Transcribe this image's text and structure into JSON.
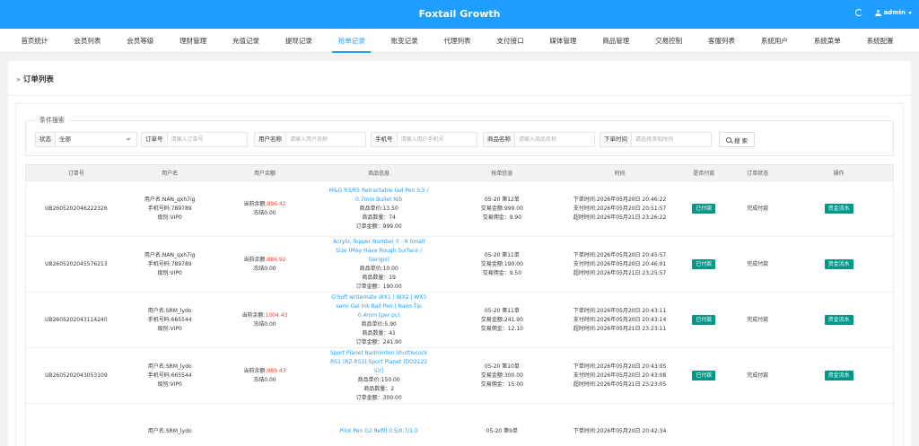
{
  "header": {
    "title": "Foxtail Growth",
    "user": "admin"
  },
  "nav": [
    "首页统计",
    "会员列表",
    "会员等级",
    "理财管理",
    "充值记录",
    "提现记录",
    "抢单记录",
    "账变记录",
    "代理列表",
    "支付接口",
    "媒体管理",
    "商品管理",
    "交易控制",
    "客服列表",
    "系统用户",
    "系统菜单",
    "系统配置"
  ],
  "page": {
    "title": "订单列表"
  },
  "search": {
    "legend": "条件搜索",
    "status_label": "状态",
    "status_value": "全部",
    "order_label": "订单号",
    "order_placeholder": "请输入订单号",
    "username_label": "用户名称",
    "username_placeholder": "请输入用户名称",
    "phone_label": "手机号",
    "phone_placeholder": "请输入用户手机号",
    "product_label": "商品名称",
    "product_placeholder": "请输入商品名称",
    "time_label": "下单时间",
    "time_placeholder": "请选择添加时间",
    "search_button": "搜 索"
  },
  "table": {
    "headers": [
      "订单号",
      "用户名",
      "用户余额",
      "商品信息",
      "抢单信息",
      "时间",
      "是否付款",
      "订单状态",
      "操作"
    ],
    "rows": [
      {
        "order_no": "UB2605202046222326",
        "user_line1": "用户名:NAN_qxh7ig",
        "user_line2": "手机号码:789789",
        "user_line3": "级别:VIP0",
        "balance_label": "当前余额:",
        "balance_value": "896.42",
        "frozen": "冻结0.00",
        "product_name": "M&G R3/R5 Retractable Gel Pen 0.5 / 0.7mm Bullet Nib",
        "unit_price": "商品单价:13.50",
        "qty": "商品数量：74",
        "total": "订单金额：999.00",
        "grab_line1": "05-20 第12单",
        "grab_line2": "交易金额:999.00",
        "grab_line3": "交易佣金：9.90",
        "time_line1": "下单时间:2026年05月20日 20:46:22",
        "time_line2": "支付时间:2026年05月20日 20:51:57",
        "time_line3": "超时时间:2026年05月21日 23:26:22",
        "paid": "已付款",
        "status": "完成付款",
        "action": "资金流水"
      },
      {
        "order_no": "UB2605202045576213",
        "user_line1": "用户名:NAN_qxh7ig",
        "user_line2": "手机号码:789789",
        "user_line3": "级别:VIP0",
        "balance_label": "当前余额:",
        "balance_value": "886.92",
        "frozen": "冻结0.00",
        "product_name": "Acrylic Topper Number 0 - 9 Small Size (May Have Rough Surface / Gerigis)",
        "unit_price": "商品单价:10.00",
        "qty": "商品数量：19",
        "total": "订单金额：190.00",
        "grab_line1": "05-20 第11单",
        "grab_line2": "交易金额:190.00",
        "grab_line3": "交易佣金：9.50",
        "time_line1": "下单时间:2026年05月20日 20:45:57",
        "time_line2": "支付时间:2026年05月20日 20:46:01",
        "time_line3": "超时时间:2026年05月21日 23:25:57",
        "paid": "已付款",
        "status": "完成付款",
        "action": "资金流水"
      },
      {
        "order_no": "UB2605202043114240",
        "user_line1": "用户名:SRM_lydo",
        "user_line2": "手机号码:665544",
        "user_line3": "级别:VIP0",
        "balance_label": "当前余额:",
        "balance_value": "1004.43",
        "frozen": "冻结0.00",
        "product_name": "G'Soft writemate WX1 | WX2 | WX3 semi Gel Ink Ball Pen | Nano Tip 0.4mm (per pc)",
        "unit_price": "商品单价:5.90",
        "qty": "商品数量：41",
        "total": "订单金额：241.90",
        "grab_line1": "05-20 第11单",
        "grab_line2": "交易金额:241.90",
        "grab_line3": "交易佣金：12.10",
        "time_line1": "下单时间:2026年05月20日 20:43:11",
        "time_line2": "支付时间:2026年05月20日 20:43:14",
        "time_line3": "超时时间:2026年05月21日 23:23:11",
        "paid": "已付款",
        "status": "完成付款",
        "action": "资金流水"
      },
      {
        "order_no": "UB2605202043053109",
        "user_line1": "用户名:SRM_lydo",
        "user_line2": "手机号码:665544",
        "user_line3": "级别:VIP0",
        "balance_label": "当前余额:",
        "balance_value": "989.43",
        "frozen": "冻结0.00",
        "product_name": "Sport Planet Badminton Shuttlecock RS1 (RZ-RS1) Sport Planet (DO2122 S)()",
        "unit_price": "商品单价:150.00",
        "qty": "商品数量：2",
        "total": "订单金额：300.00",
        "grab_line1": "05-20 第10单",
        "grab_line2": "交易金额:300.00",
        "grab_line3": "交易佣金：15.00",
        "time_line1": "下单时间:2026年05月20日 20:43:05",
        "time_line2": "支付时间:2026年05月20日 20:43:08",
        "time_line3": "超时时间:2026年05月21日 23:23:05",
        "paid": "已付款",
        "status": "完成付款",
        "action": "资金流水"
      },
      {
        "order_no": "",
        "user_line1": "用户名:SRM_lydo",
        "user_line2": "",
        "user_line3": "",
        "balance_label": "",
        "balance_value": "",
        "frozen": "",
        "product_name": "Pilot Pen G2 Refill 0.5/0.7/1.0",
        "unit_price": "",
        "qty": "",
        "total": "",
        "grab_line1": "05-20 第9单",
        "grab_line2": "",
        "grab_line3": "",
        "time_line1": "下单时间:2026年05月20日 20:42:34",
        "time_line2": "",
        "time_line3": "",
        "paid": "",
        "status": "",
        "action": ""
      }
    ]
  }
}
